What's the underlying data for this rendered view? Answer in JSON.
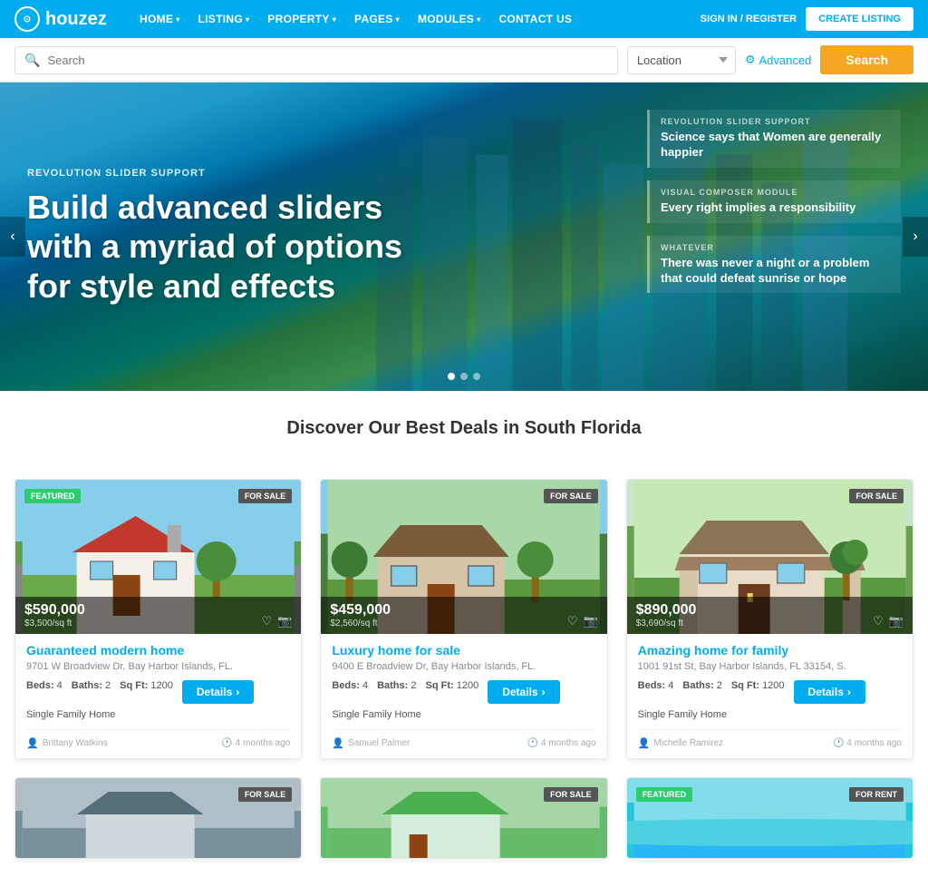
{
  "navbar": {
    "logo": "houzez",
    "logo_symbol": "⊙",
    "menu": [
      {
        "label": "HOME",
        "has_dropdown": true
      },
      {
        "label": "LISTING",
        "has_dropdown": true
      },
      {
        "label": "PROPERTY",
        "has_dropdown": true
      },
      {
        "label": "PAGES",
        "has_dropdown": true
      },
      {
        "label": "MODULES",
        "has_dropdown": true
      },
      {
        "label": "CONTACT US",
        "has_dropdown": false
      }
    ],
    "sign_in": "SIGN IN / REGISTER",
    "create_listing": "CREATE LISTING"
  },
  "search_bar": {
    "placeholder": "Search",
    "location_label": "Location",
    "advanced_label": "Advanced",
    "search_button": "Search"
  },
  "hero": {
    "subtitle": "REVOLUTION SLIDER SUPPORT",
    "title": "Build advanced sliders with a myriad of options for style and effects",
    "side_items": [
      {
        "label": "REVOLUTION SLIDER SUPPORT",
        "text": "Science says that Women are generally happier"
      },
      {
        "label": "VISUAL COMPOSER MODULE",
        "text": "Every right implies a responsibility"
      },
      {
        "label": "WHATEVER",
        "text": "There was never a night or a problem that could defeat sunrise or hope"
      }
    ]
  },
  "section": {
    "title": "Discover Our Best Deals in South Florida"
  },
  "properties": [
    {
      "id": 1,
      "price": "$590,000",
      "price_sqft": "$3,500/sq ft",
      "featured": true,
      "status": "FOR SALE",
      "title": "Guaranteed modern home",
      "address": "9701 W Broadview Dr, Bay Harbor Islands, FL.",
      "beds": "4",
      "baths": "2",
      "sqft": "1200",
      "type": "Single Family Home",
      "agent": "Brittany Watkins",
      "time": "4 months ago"
    },
    {
      "id": 2,
      "price": "$459,000",
      "price_sqft": "$2,560/sq ft",
      "featured": false,
      "status": "FOR SALE",
      "title": "Luxury home for sale",
      "address": "9400 E Broadview Dr, Bay Harbor Islands, FL.",
      "beds": "4",
      "baths": "2",
      "sqft": "1200",
      "type": "Single Family Home",
      "agent": "Samuel Palmer",
      "time": "4 months ago"
    },
    {
      "id": 3,
      "price": "$890,000",
      "price_sqft": "$3,690/sq ft",
      "featured": false,
      "status": "FOR SALE",
      "title": "Amazing home for family",
      "address": "1001 91st St, Bay Harbor Islands, FL 33154, S.",
      "beds": "4",
      "baths": "2",
      "sqft": "1200",
      "type": "Single Family Home",
      "agent": "Michelle Ramirez",
      "time": "4 months ago"
    }
  ],
  "partial_properties": [
    {
      "status": "FOR SALE",
      "featured": false
    },
    {
      "status": "FOR SALE",
      "featured": false
    },
    {
      "status": "FOR RENT",
      "featured": true
    }
  ],
  "details_button": "Details",
  "beds_label": "Beds:",
  "baths_label": "Baths:",
  "sqft_label": "Sq Ft:",
  "colors": {
    "primary": "#00aeef",
    "orange": "#f5a623",
    "green": "#2ecc71",
    "dark_badge": "#555555"
  }
}
